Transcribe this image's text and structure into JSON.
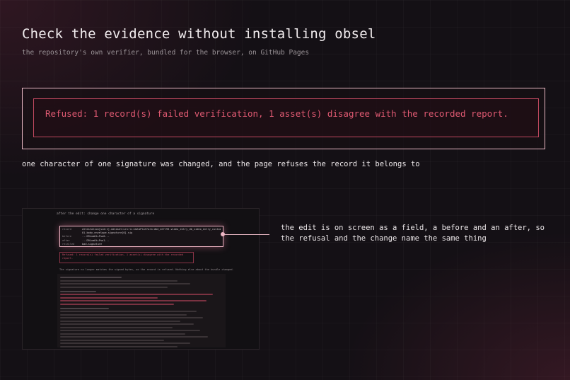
{
  "header": {
    "title": "Check the evidence without installing obsel",
    "subtitle": "the repository's own verifier, bundled for the browser, on GitHub Pages"
  },
  "callout": {
    "message": "Refused: 1 record(s) failed verification, 1 asset(s) disagree with the recorded report.",
    "accent_color": "#e05a72",
    "outer_border_color": "#e9b8c4"
  },
  "caption": "one character of one signature was changed, and the page refuses the record it belongs to",
  "thumbnail": {
    "heading": "after the edit: change one character of a signature",
    "field_rows": [
      {
        "key": "record",
        "value": "attestation[sid:1].dataset:urn:li:dataPlatform:db4_mlfl93.video_entry_db_video_entry_customers_PRD93"
      },
      {
        "key": "",
        "value": "01.body.envelope.signature[0].sig"
      },
      {
        "key": "before",
        "value": "...D9LumOt+Psa0..."
      },
      {
        "key": "after",
        "value": "...D9LumOt+Psa1..."
      },
      {
        "key": "recalled",
        "value": "bad-signature"
      }
    ],
    "refused_text": "Refused: 1 record(s) failed verification, 1 asset(s) disagree with the recorded report.",
    "note": "The signature no longer matches the signed bytes, so the record is refused. Nothing else about the bundle changed."
  },
  "side_note": "the edit is on screen as a field, a before and an after, so the refusal and the change name the same thing"
}
